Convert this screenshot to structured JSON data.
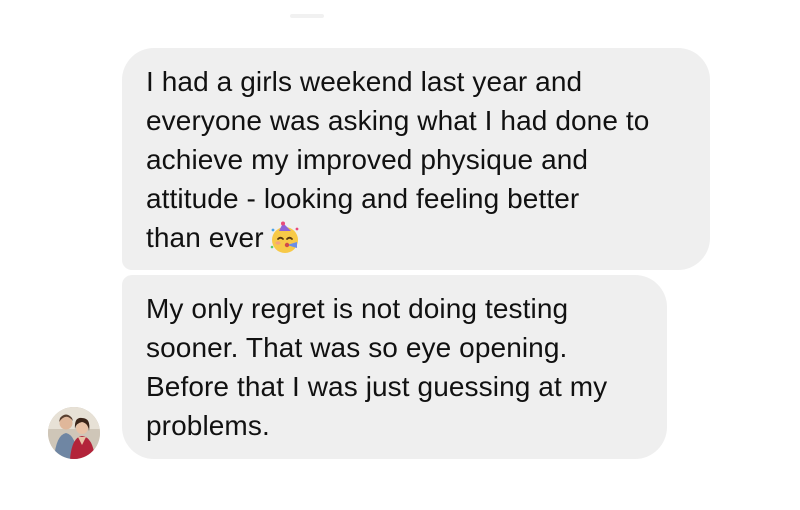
{
  "conversation": {
    "messages": [
      {
        "lines": [
          "I had a girls weekend last year and",
          "everyone was asking what I had done to",
          "achieve my improved physique and",
          "attitude - looking and feeling better",
          "than ever"
        ],
        "trailing_icon": "partying-face-emoji-icon"
      },
      {
        "lines": [
          "My only regret is not doing testing",
          "sooner. That was so eye opening.",
          "Before that I was just guessing at my",
          "problems."
        ]
      }
    ],
    "sender": {
      "avatar_icon": "profile-photo-avatar"
    }
  },
  "colors": {
    "bubble_background": "#efefef",
    "text": "#111111",
    "page_background": "#ffffff"
  }
}
